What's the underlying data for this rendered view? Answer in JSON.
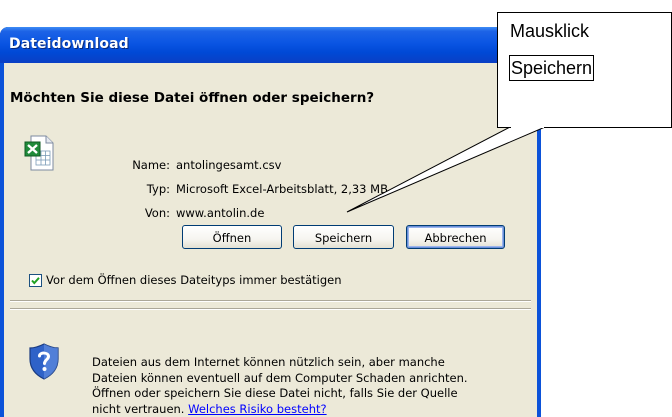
{
  "dialog": {
    "title": "Dateidownload",
    "question": "Möchten Sie diese Datei öffnen oder speichern?",
    "file_icon": "excel-csv-file-icon",
    "info": {
      "name_label": "Name:",
      "name_value": "antolingesamt.csv",
      "type_label": "Typ:",
      "type_value": "Microsoft Excel-Arbeitsblatt, 2,33 MB",
      "from_label": "Von:",
      "from_value": "www.antolin.de"
    },
    "buttons": {
      "open": "Öffnen",
      "save": "Speichern",
      "cancel": "Abbrechen"
    },
    "checkbox": {
      "label": "Vor dem Öffnen dieses Dateityps immer bestätigen",
      "checked": true
    },
    "warning": {
      "icon": "security-shield-icon",
      "line1": "Dateien aus dem Internet können nützlich sein, aber manche",
      "line2": "Dateien können eventuell auf dem Computer Schaden anrichten.",
      "line3": "Öffnen oder speichern Sie diese Datei nicht, falls Sie der Quelle",
      "line4_text": "nicht vertrauen. ",
      "link": "Welches Risiko besteht?"
    }
  },
  "callout": {
    "line1": "Mausklick",
    "line2": "Speichern"
  },
  "colors": {
    "titlebar": "#0a55e3",
    "client_bg": "#ece9d8",
    "link": "#0000ff",
    "button_border": "#003c74"
  }
}
